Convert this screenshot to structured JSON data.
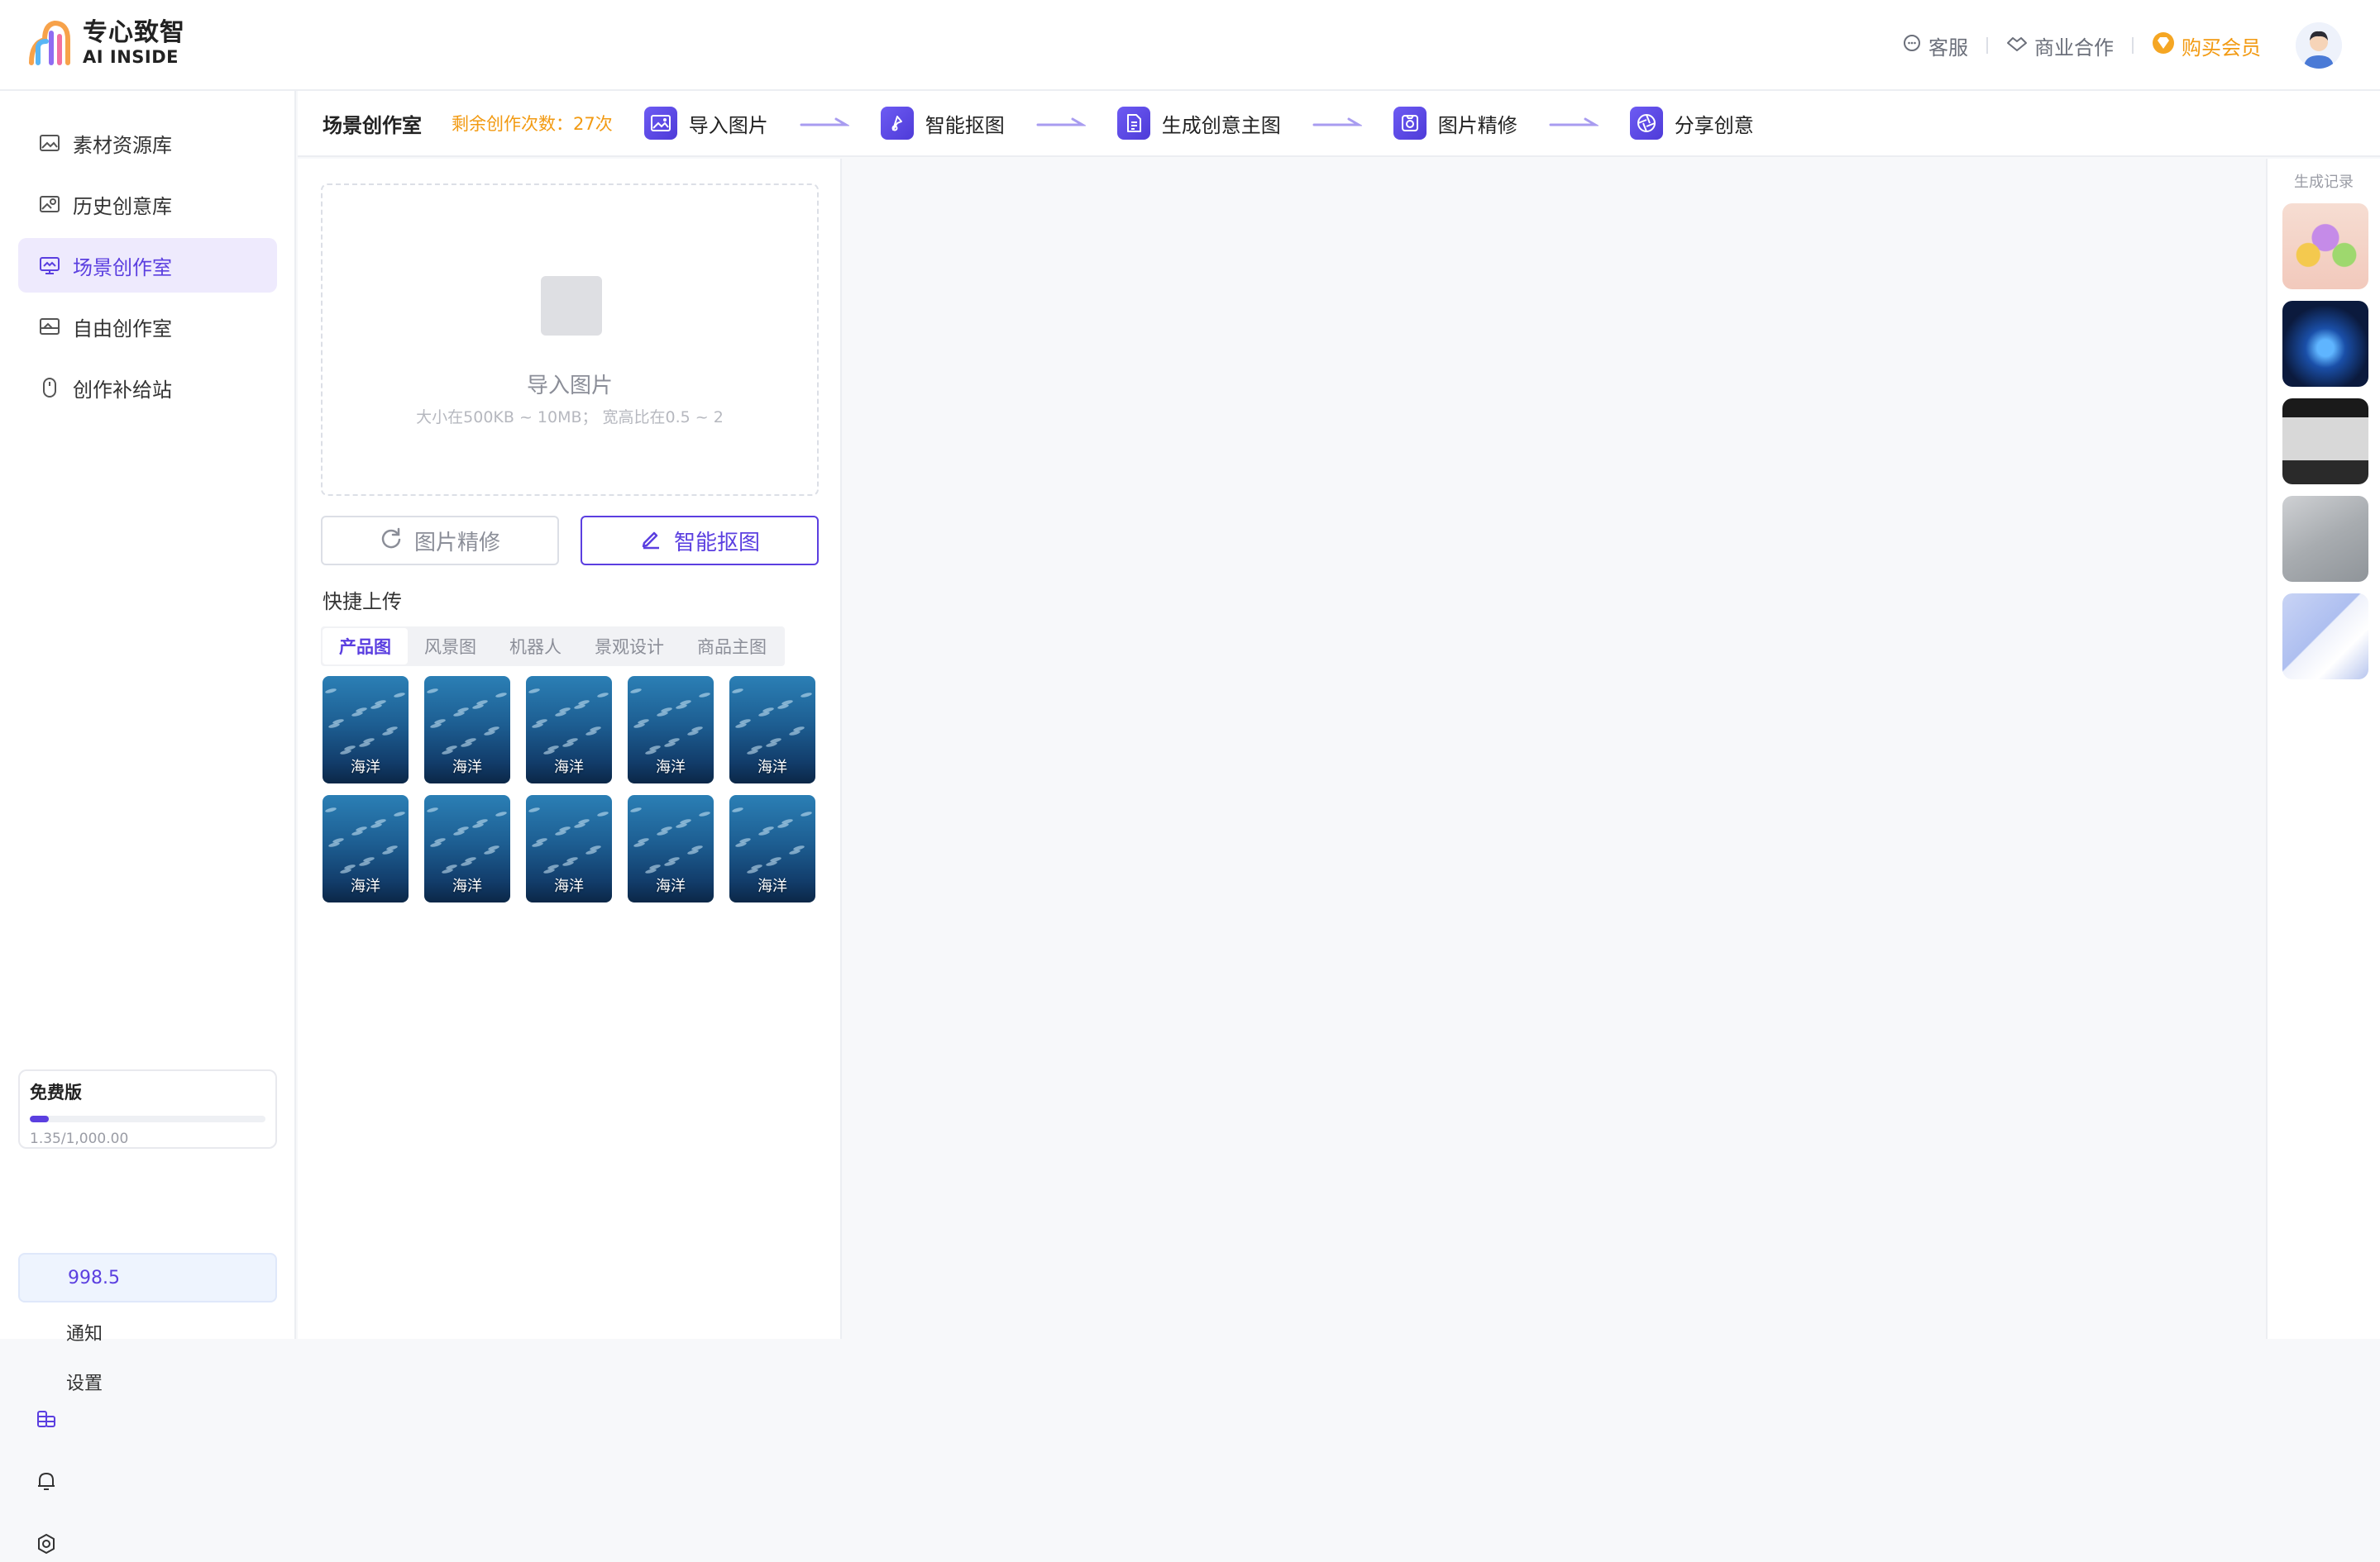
{
  "brand": {
    "name_cn": "专心致智",
    "name_en": "AI INSIDE",
    "accent": "#5b3fe0",
    "vip_color": "#f29a12"
  },
  "header": {
    "support": "客服",
    "business": "商业合作",
    "vip": "购买会员"
  },
  "sidebar": {
    "items": [
      {
        "label": "素材资源库",
        "icon": "image-icon"
      },
      {
        "label": "历史创意库",
        "icon": "history-image-icon"
      },
      {
        "label": "场景创作室",
        "icon": "scene-studio-icon",
        "active": true
      },
      {
        "label": "自由创作室",
        "icon": "landscape-icon"
      },
      {
        "label": "创作补给站",
        "icon": "mouse-icon"
      }
    ],
    "plan": {
      "name": "免费版",
      "usage": "1.35/1,000.00",
      "progress_fraction": 0.00135
    },
    "credits": "998.5",
    "notify": "通知",
    "settings": "设置"
  },
  "stepbar": {
    "title": "场景创作室",
    "remaining": "剩余创作次数：27次",
    "steps": [
      {
        "label": "导入图片",
        "icon": "image-import-icon"
      },
      {
        "label": "智能抠图",
        "icon": "cutout-icon"
      },
      {
        "label": "生成创意主图",
        "icon": "document-icon"
      },
      {
        "label": "图片精修",
        "icon": "camera-icon"
      },
      {
        "label": "分享创意",
        "icon": "aperture-icon"
      }
    ]
  },
  "upload": {
    "title": "导入图片",
    "hint": "大小在500KB ~ 10MB； 宽高比在0.5 ~ 2",
    "refine_button": "图片精修",
    "cutout_button": "智能抠图"
  },
  "quick": {
    "title": "快捷上传",
    "tabs": [
      "产品图",
      "风景图",
      "机器人",
      "景观设计",
      "商品主图"
    ],
    "active_tab": 0,
    "thumbs": [
      "海洋",
      "海洋",
      "海洋",
      "海洋",
      "海洋",
      "海洋",
      "海洋",
      "海洋",
      "海洋",
      "海洋"
    ]
  },
  "history": {
    "title": "生成记录",
    "items": [
      "colorful-figurines",
      "glowing-chip",
      "white-device",
      "cosmetic-tube",
      "product-card"
    ]
  }
}
